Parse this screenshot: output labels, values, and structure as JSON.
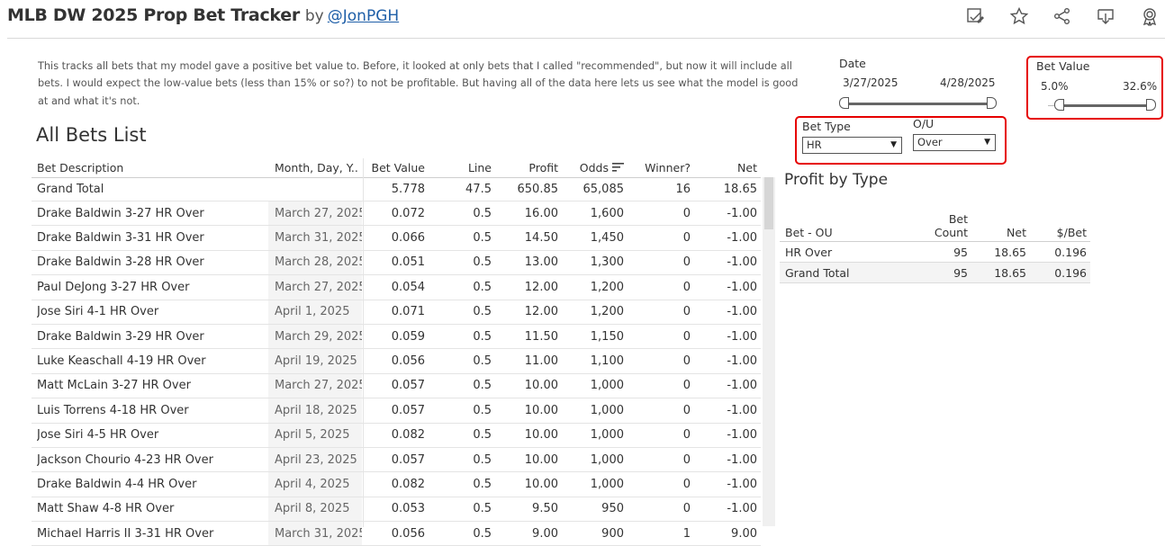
{
  "header": {
    "title": "MLB DW 2025 Prop Bet Tracker",
    "by": "by",
    "author": "@JonPGH",
    "icons": [
      "edit-icon",
      "star-icon",
      "share-icon",
      "download-icon",
      "badge-icon"
    ]
  },
  "description": "This tracks all bets that my model gave a positive bet value to. Before, it looked at only bets that I called \"recommended\", but now it will include all bets. I would expect the low-value bets (less than 15% or so?) to not be profitable. But having all of the data here lets us see what the model is good at and what it's not.",
  "table": {
    "title": "All Bets List",
    "columns": [
      "Bet Description",
      "Month, Day, Y..",
      "Bet Value",
      "Line",
      "Profit",
      "Odds",
      "Winner?",
      "Net"
    ],
    "grand_total": [
      "Grand Total",
      "",
      "5.778",
      "47.5",
      "650.85",
      "65,085",
      "16",
      "18.65"
    ],
    "rows": [
      [
        "Drake Baldwin 3-27 HR Over",
        "March 27, 2025",
        "0.072",
        "0.5",
        "16.00",
        "1,600",
        "0",
        "-1.00"
      ],
      [
        "Drake Baldwin 3-31 HR Over",
        "March 31, 2025",
        "0.066",
        "0.5",
        "14.50",
        "1,450",
        "0",
        "-1.00"
      ],
      [
        "Drake Baldwin 3-28 HR Over",
        "March 28, 2025",
        "0.051",
        "0.5",
        "13.00",
        "1,300",
        "0",
        "-1.00"
      ],
      [
        "Paul DeJong 3-27 HR Over",
        "March 27, 2025",
        "0.054",
        "0.5",
        "12.00",
        "1,200",
        "0",
        "-1.00"
      ],
      [
        "Jose Siri 4-1 HR Over",
        "April 1, 2025",
        "0.071",
        "0.5",
        "12.00",
        "1,200",
        "0",
        "-1.00"
      ],
      [
        "Drake Baldwin 3-29 HR Over",
        "March 29, 2025",
        "0.059",
        "0.5",
        "11.50",
        "1,150",
        "0",
        "-1.00"
      ],
      [
        "Luke Keaschall 4-19 HR Over",
        "April 19, 2025",
        "0.056",
        "0.5",
        "11.00",
        "1,100",
        "0",
        "-1.00"
      ],
      [
        "Matt McLain 3-27 HR Over",
        "March 27, 2025",
        "0.057",
        "0.5",
        "10.00",
        "1,000",
        "0",
        "-1.00"
      ],
      [
        "Luis Torrens 4-18 HR Over",
        "April 18, 2025",
        "0.057",
        "0.5",
        "10.00",
        "1,000",
        "0",
        "-1.00"
      ],
      [
        "Jose Siri 4-5 HR Over",
        "April 5, 2025",
        "0.082",
        "0.5",
        "10.00",
        "1,000",
        "0",
        "-1.00"
      ],
      [
        "Jackson Chourio 4-23 HR Over",
        "April 23, 2025",
        "0.057",
        "0.5",
        "10.00",
        "1,000",
        "0",
        "-1.00"
      ],
      [
        "Drake Baldwin 4-4 HR Over",
        "April 4, 2025",
        "0.082",
        "0.5",
        "10.00",
        "1,000",
        "0",
        "-1.00"
      ],
      [
        "Matt Shaw 4-8 HR Over",
        "April 8, 2025",
        "0.053",
        "0.5",
        "9.50",
        "950",
        "0",
        "-1.00"
      ],
      [
        "Michael Harris II 3-31 HR Over",
        "March 31, 2025",
        "0.056",
        "0.5",
        "9.00",
        "900",
        "1",
        "9.00"
      ]
    ]
  },
  "filters": {
    "date": {
      "title": "Date",
      "start": "3/27/2025",
      "end": "4/28/2025"
    },
    "bet_value": {
      "title": "Bet Value",
      "min": "5.0%",
      "max": "32.6%"
    },
    "bet_type": {
      "title": "Bet Type",
      "selected": "HR"
    },
    "ou": {
      "title": "O/U",
      "selected": "Over"
    },
    "highlight_color": "#e60000"
  },
  "summary": {
    "title": "Profit by Type",
    "headers": {
      "name": "Bet - OU",
      "count_line1": "Bet",
      "count_line2": "Count",
      "net": "Net",
      "per_bet": "$/Bet"
    },
    "rows": [
      {
        "name": "HR Over",
        "count": "95",
        "net": "18.65",
        "per_bet": "0.196"
      },
      {
        "name": "Grand Total",
        "count": "95",
        "net": "18.65",
        "per_bet": "0.196"
      }
    ]
  }
}
